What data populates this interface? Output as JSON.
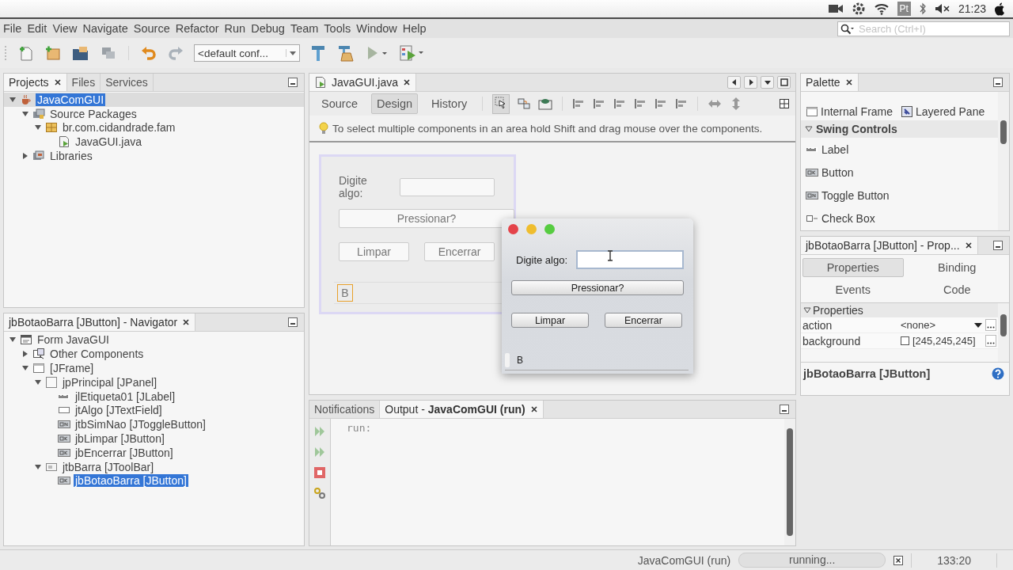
{
  "system_bar": {
    "input_method": "Pt",
    "clock": "21:23"
  },
  "menu_bar": [
    "File",
    "Edit",
    "View",
    "Navigate",
    "Source",
    "Refactor",
    "Run",
    "Debug",
    "Team",
    "Tools",
    "Window",
    "Help"
  ],
  "toolbar": {
    "configuration": "<default conf...",
    "search": {
      "placeholder": "Search (Ctrl+I)"
    }
  },
  "projects_panel": {
    "tabs": [
      {
        "label": "Projects",
        "selected": true,
        "closable": true
      },
      {
        "label": "Files",
        "selected": false,
        "closable": false
      },
      {
        "label": "Services",
        "selected": false,
        "closable": false
      }
    ],
    "tree": [
      {
        "label": "JavaComGUI",
        "kind": "project",
        "selected": true,
        "expanded": true,
        "children": [
          {
            "label": "Source Packages",
            "kind": "source-packages",
            "selected": false,
            "expanded": true,
            "children": [
              {
                "label": "br.com.cidandrade.fam",
                "kind": "package",
                "selected": false,
                "expanded": true,
                "children": [
                  {
                    "label": "JavaGUI.java",
                    "kind": "java-file",
                    "selected": false
                  }
                ]
              }
            ]
          },
          {
            "label": "Libraries",
            "kind": "libraries",
            "selected": false,
            "expanded": false
          }
        ]
      }
    ]
  },
  "navigator_panel": {
    "title": "jbBotaoBarra [JButton] - Navigator",
    "tree": [
      {
        "label": "Form JavaGUI",
        "kind": "form",
        "selected": false,
        "expanded": true,
        "children": [
          {
            "label": "Other Components",
            "kind": "other-components",
            "selected": false,
            "expanded": false
          },
          {
            "label": "[JFrame]",
            "kind": "frame",
            "selected": false,
            "expanded": true,
            "children": [
              {
                "label": "jpPrincipal [JPanel]",
                "kind": "panel",
                "selected": false,
                "expanded": true,
                "children": [
                  {
                    "label": "jlEtiqueta01 [JLabel]",
                    "kind": "label",
                    "selected": false
                  },
                  {
                    "label": "jtAlgo [JTextField]",
                    "kind": "text-field",
                    "selected": false
                  },
                  {
                    "label": "jtbSimNao [JToggleButton]",
                    "kind": "toggle-button",
                    "selected": false
                  },
                  {
                    "label": "jbLimpar [JButton]",
                    "kind": "button",
                    "selected": false
                  },
                  {
                    "label": "jbEncerrar [JButton]",
                    "kind": "button",
                    "selected": false
                  }
                ]
              },
              {
                "label": "jtbBarra [JToolBar]",
                "kind": "toolbar",
                "selected": false,
                "expanded": true,
                "children": [
                  {
                    "label": "jbBotaoBarra [JButton]",
                    "kind": "button",
                    "selected": true
                  }
                ]
              }
            ]
          }
        ]
      }
    ]
  },
  "editor": {
    "tabs": [
      {
        "label": "JavaGUI.java",
        "selected": true
      }
    ],
    "views": [
      {
        "label": "Source",
        "selected": false
      },
      {
        "label": "Design",
        "selected": true
      },
      {
        "label": "History",
        "selected": false
      }
    ],
    "hint": "To select multiple components in an area hold Shift and drag mouse over the components.",
    "form": {
      "label": "Digite algo:",
      "toggle_button": "Pressionar?",
      "buttons": [
        "Limpar",
        "Encerrar"
      ],
      "toolbar_button": {
        "label": "B",
        "selected": true
      }
    }
  },
  "running_window": {
    "label": "Digite algo:",
    "toggle_button": "Pressionar?",
    "buttons": [
      "Limpar",
      "Encerrar"
    ],
    "toolbar_button": "B"
  },
  "palette": {
    "title": "Palette",
    "groups": [
      {
        "items": [
          {
            "label": "Internal Frame",
            "kind": "internal-frame"
          },
          {
            "label": "Layered Pane",
            "kind": "layered-pane"
          }
        ]
      },
      {
        "title": "Swing Controls",
        "expanded": true,
        "items": [
          {
            "label": "Label",
            "kind": "label"
          },
          {
            "label": "Button",
            "kind": "button"
          },
          {
            "label": "Toggle Button",
            "kind": "toggle-button"
          },
          {
            "label": "Check Box",
            "kind": "check-box"
          }
        ]
      }
    ]
  },
  "properties_panel": {
    "title": "jbBotaoBarra [JButton] - Prop...",
    "tabs": [
      {
        "label": "Properties",
        "selected": true
      },
      {
        "label": "Binding",
        "selected": false
      },
      {
        "label": "Events",
        "selected": false
      },
      {
        "label": "Code",
        "selected": false
      }
    ],
    "section": "Properties",
    "rows": [
      {
        "name": "action",
        "value": "<none>",
        "kind": "dropdown"
      },
      {
        "name": "background",
        "value": "[245,245,245]",
        "kind": "color"
      }
    ],
    "footer": "jbBotaoBarra [JButton]"
  },
  "output_panel": {
    "tabs": [
      {
        "label": "Notifications",
        "selected": false,
        "closable": false
      },
      {
        "label": "Output - **JavaComGUI (run)**",
        "selected": true,
        "closable": true
      }
    ],
    "lines": [
      "run:"
    ]
  },
  "status_bar": {
    "task": "JavaComGUI (run)",
    "progress": "running...",
    "position": "133:20"
  }
}
